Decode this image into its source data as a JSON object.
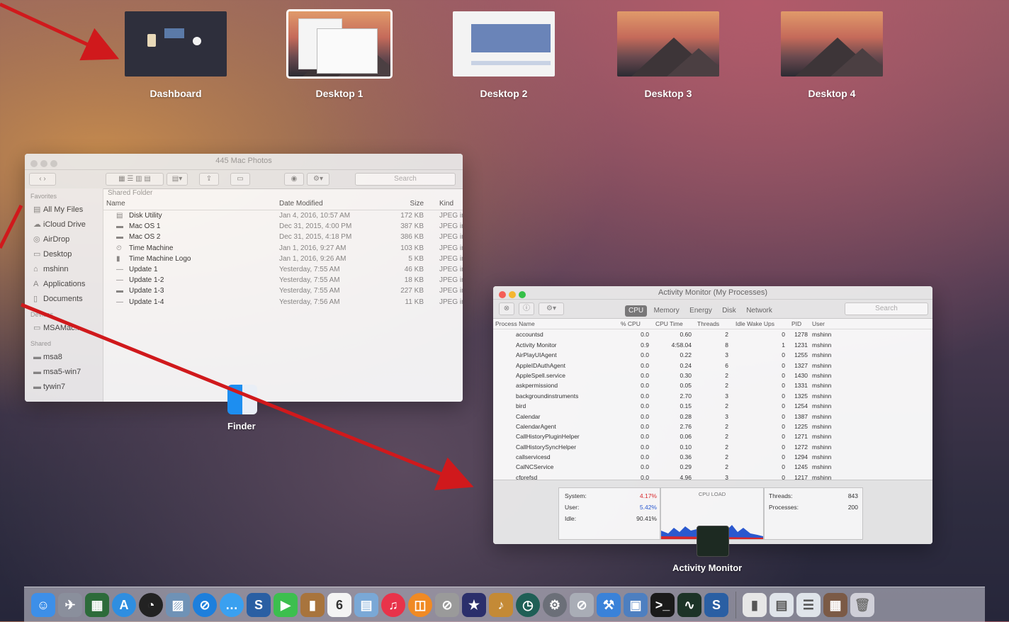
{
  "spaces": [
    {
      "label": "Dashboard",
      "selected": false
    },
    {
      "label": "Desktop 1",
      "selected": true
    },
    {
      "label": "Desktop 2",
      "selected": false
    },
    {
      "label": "Desktop 3",
      "selected": false
    },
    {
      "label": "Desktop 4",
      "selected": false
    }
  ],
  "finder": {
    "title": "445 Mac Photos",
    "search_placeholder": "Search",
    "path_header": "Shared Folder",
    "sidebar": {
      "favorites_header": "Favorites",
      "favorites": [
        "All My Files",
        "iCloud Drive",
        "AirDrop",
        "Desktop",
        "mshinn",
        "Applications",
        "Documents"
      ],
      "devices_header": "Devices",
      "devices": [
        "MSAMac..."
      ],
      "shared_header": "Shared",
      "shared": [
        "msa8",
        "msa5-win7",
        "tywin7"
      ]
    },
    "columns": {
      "name": "Name",
      "date": "Date Modified",
      "size": "Size",
      "kind": "Kind"
    },
    "files": [
      {
        "name": "Disk Utility",
        "date": "Jan 4, 2016, 10:57 AM",
        "size": "172 KB",
        "kind": "JPEG in"
      },
      {
        "name": "Mac OS 1",
        "date": "Dec 31, 2015, 4:00 PM",
        "size": "387 KB",
        "kind": "JPEG in"
      },
      {
        "name": "Mac OS 2",
        "date": "Dec 31, 2015, 4:18 PM",
        "size": "386 KB",
        "kind": "JPEG in"
      },
      {
        "name": "Time Machine",
        "date": "Jan 1, 2016, 9:27 AM",
        "size": "103 KB",
        "kind": "JPEG in"
      },
      {
        "name": "Time Machine Logo",
        "date": "Jan 1, 2016, 9:26 AM",
        "size": "5 KB",
        "kind": "JPEG in"
      },
      {
        "name": "Update 1",
        "date": "Yesterday, 7:55 AM",
        "size": "46 KB",
        "kind": "JPEG in"
      },
      {
        "name": "Update 1-2",
        "date": "Yesterday, 7:55 AM",
        "size": "18 KB",
        "kind": "JPEG in"
      },
      {
        "name": "Update 1-3",
        "date": "Yesterday, 7:55 AM",
        "size": "227 KB",
        "kind": "JPEG in"
      },
      {
        "name": "Update 1-4",
        "date": "Yesterday, 7:56 AM",
        "size": "11 KB",
        "kind": "JPEG in"
      }
    ],
    "app_label": "Finder"
  },
  "activity_monitor": {
    "title": "Activity Monitor (My Processes)",
    "tabs": [
      "CPU",
      "Memory",
      "Energy",
      "Disk",
      "Network"
    ],
    "active_tab": "CPU",
    "search_placeholder": "Search",
    "columns": {
      "name": "Process Name",
      "cpu": "% CPU",
      "time": "CPU Time",
      "threads": "Threads",
      "idle": "Idle Wake Ups",
      "pid": "PID",
      "user": "User"
    },
    "processes": [
      {
        "name": "accountsd",
        "cpu": "0.0",
        "time": "0.60",
        "threads": "2",
        "idle": "0",
        "pid": "1278",
        "user": "mshinn"
      },
      {
        "name": "Activity Monitor",
        "cpu": "0.9",
        "time": "4:58.04",
        "threads": "8",
        "idle": "1",
        "pid": "1231",
        "user": "mshinn"
      },
      {
        "name": "AirPlayUIAgent",
        "cpu": "0.0",
        "time": "0.22",
        "threads": "3",
        "idle": "0",
        "pid": "1255",
        "user": "mshinn"
      },
      {
        "name": "AppleIDAuthAgent",
        "cpu": "0.0",
        "time": "0.24",
        "threads": "6",
        "idle": "0",
        "pid": "1327",
        "user": "mshinn"
      },
      {
        "name": "AppleSpell.service",
        "cpu": "0.0",
        "time": "0.30",
        "threads": "2",
        "idle": "0",
        "pid": "1430",
        "user": "mshinn"
      },
      {
        "name": "askpermissiond",
        "cpu": "0.0",
        "time": "0.05",
        "threads": "2",
        "idle": "0",
        "pid": "1331",
        "user": "mshinn"
      },
      {
        "name": "backgroundinstruments",
        "cpu": "0.0",
        "time": "2.70",
        "threads": "3",
        "idle": "0",
        "pid": "1325",
        "user": "mshinn"
      },
      {
        "name": "bird",
        "cpu": "0.0",
        "time": "0.15",
        "threads": "2",
        "idle": "0",
        "pid": "1254",
        "user": "mshinn"
      },
      {
        "name": "Calendar",
        "cpu": "0.0",
        "time": "0.28",
        "threads": "3",
        "idle": "0",
        "pid": "1387",
        "user": "mshinn"
      },
      {
        "name": "CalendarAgent",
        "cpu": "0.0",
        "time": "2.76",
        "threads": "2",
        "idle": "0",
        "pid": "1225",
        "user": "mshinn"
      },
      {
        "name": "CallHistoryPluginHelper",
        "cpu": "0.0",
        "time": "0.06",
        "threads": "2",
        "idle": "0",
        "pid": "1271",
        "user": "mshinn"
      },
      {
        "name": "CallHistorySyncHelper",
        "cpu": "0.0",
        "time": "0.10",
        "threads": "2",
        "idle": "0",
        "pid": "1272",
        "user": "mshinn"
      },
      {
        "name": "callservicesd",
        "cpu": "0.0",
        "time": "0.36",
        "threads": "2",
        "idle": "0",
        "pid": "1294",
        "user": "mshinn"
      },
      {
        "name": "CalNCService",
        "cpu": "0.0",
        "time": "0.29",
        "threads": "2",
        "idle": "0",
        "pid": "1245",
        "user": "mshinn"
      },
      {
        "name": "cfprefsd",
        "cpu": "0.0",
        "time": "4.96",
        "threads": "3",
        "idle": "0",
        "pid": "1217",
        "user": "mshinn"
      }
    ],
    "footer": {
      "system_label": "System:",
      "system_value": "4.17%",
      "user_label": "User:",
      "user_value": "5.42%",
      "idle_label": "Idle:",
      "idle_value": "90.41%",
      "cpu_load_label": "CPU LOAD",
      "threads_label": "Threads:",
      "threads_value": "843",
      "processes_label": "Processes:",
      "processes_value": "200"
    },
    "app_label": "Activity Monitor"
  },
  "calendar_day": "6",
  "colors": {
    "arrow": "#d0191c",
    "system": "#e0282a",
    "user": "#2a5bd7"
  }
}
